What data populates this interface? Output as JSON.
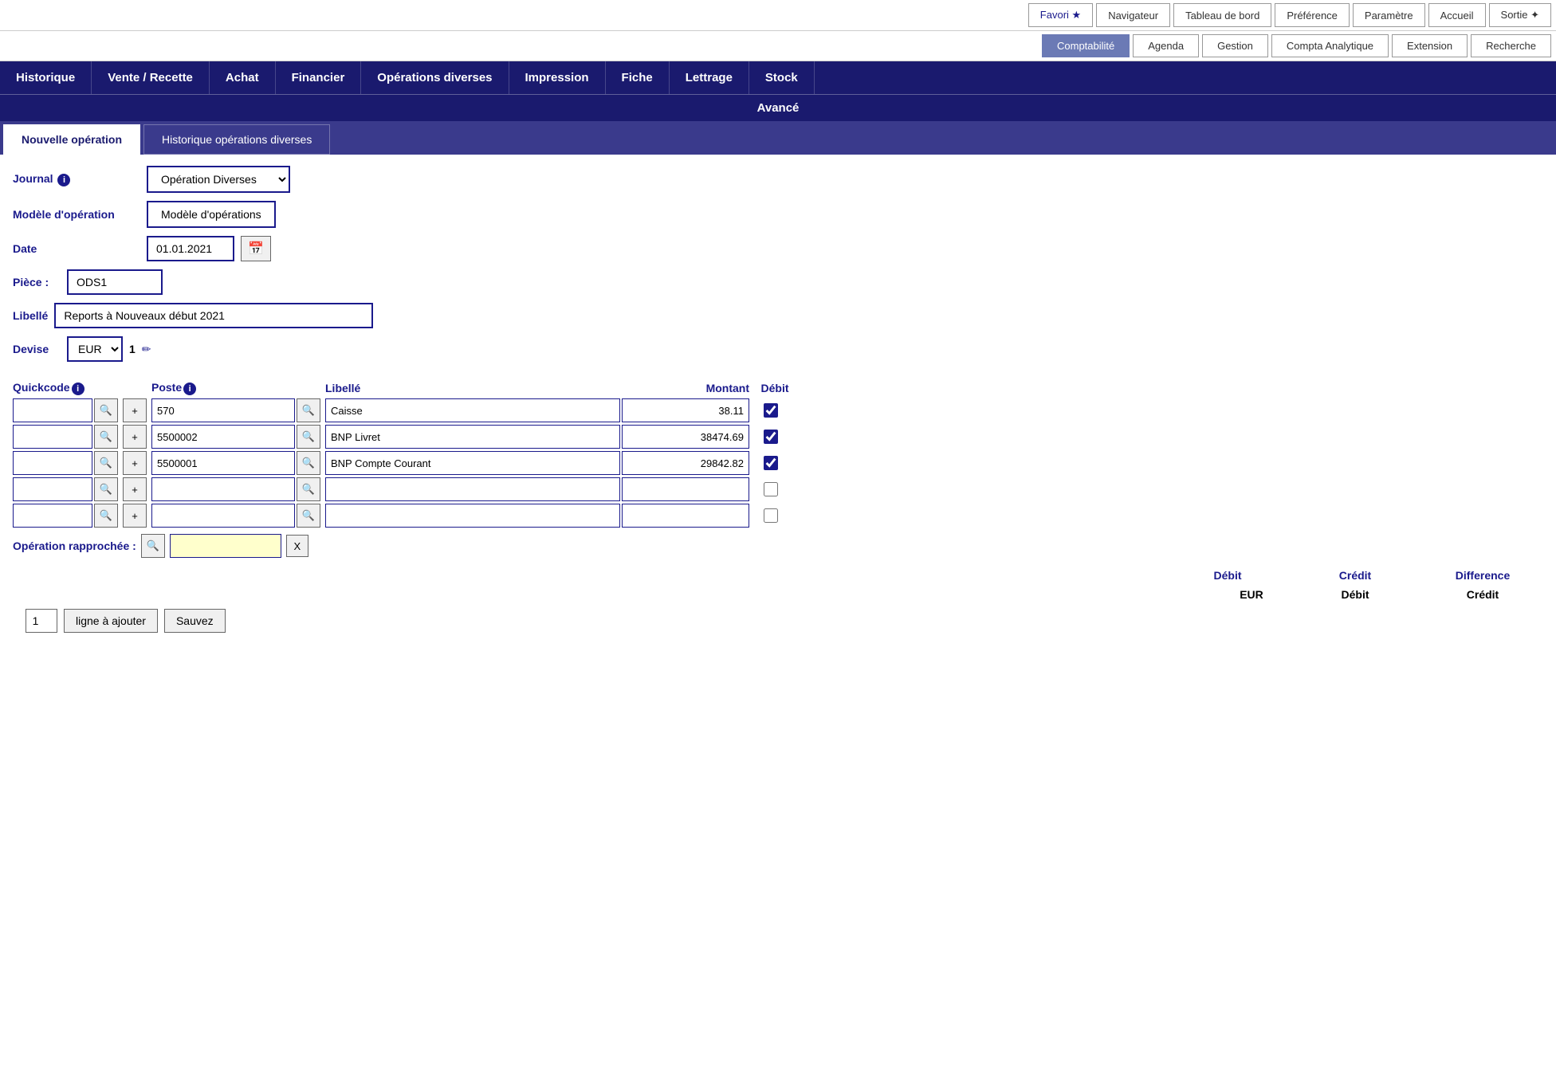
{
  "topNav": {
    "items": [
      {
        "id": "favori",
        "label": "Favori ★"
      },
      {
        "id": "navigateur",
        "label": "Navigateur"
      },
      {
        "id": "tableau-de-bord",
        "label": "Tableau de bord"
      },
      {
        "id": "preference",
        "label": "Préférence"
      },
      {
        "id": "parametre",
        "label": "Paramètre"
      },
      {
        "id": "accueil",
        "label": "Accueil"
      },
      {
        "id": "sortie",
        "label": "Sortie ✦"
      }
    ]
  },
  "secondNav": {
    "items": [
      {
        "id": "comptabilite",
        "label": "Comptabilité",
        "active": true
      },
      {
        "id": "agenda",
        "label": "Agenda"
      },
      {
        "id": "gestion",
        "label": "Gestion"
      },
      {
        "id": "compta-analytique",
        "label": "Compta Analytique"
      },
      {
        "id": "extension",
        "label": "Extension"
      },
      {
        "id": "recherche",
        "label": "Recherche"
      }
    ]
  },
  "mainMenu": {
    "items": [
      {
        "id": "historique",
        "label": "Historique"
      },
      {
        "id": "vente-recette",
        "label": "Vente / Recette"
      },
      {
        "id": "achat",
        "label": "Achat"
      },
      {
        "id": "financier",
        "label": "Financier"
      },
      {
        "id": "operations-diverses",
        "label": "Opérations diverses"
      },
      {
        "id": "impression",
        "label": "Impression"
      },
      {
        "id": "fiche",
        "label": "Fiche"
      },
      {
        "id": "lettrage",
        "label": "Lettrage"
      },
      {
        "id": "stock",
        "label": "Stock"
      }
    ]
  },
  "avanceBar": {
    "label": "Avancé"
  },
  "subTabs": {
    "items": [
      {
        "id": "nouvelle-operation",
        "label": "Nouvelle opération",
        "active": true
      },
      {
        "id": "historique-operations",
        "label": "Historique opérations diverses"
      }
    ]
  },
  "form": {
    "journalLabel": "Journal",
    "journalValue": "Opération Diverses",
    "modeleLabel": "Modèle d'opération",
    "modeleBtn": "Modèle d'opérations",
    "dateLabel": "Date",
    "dateValue": "01.01.2021",
    "pieceLabel": "Pièce :",
    "pieceValue": "ODS1",
    "libelleLabelMain": "Libellé",
    "libelleValue": "Reports à Nouveaux début 2021",
    "deviseLabel": "Devise",
    "deviseValue": "EUR",
    "deviseNum": "1",
    "calendarIcon": "📅",
    "editIcon": "✏"
  },
  "grid": {
    "headers": {
      "quickcode": "Quickcode",
      "poste": "Poste",
      "libelle": "Libellé",
      "montant": "Montant",
      "debit": "Débit"
    },
    "rows": [
      {
        "quickcode": "",
        "poste": "570",
        "libelle": "Caisse",
        "montant": "38.11",
        "debit": true,
        "empty": false
      },
      {
        "quickcode": "",
        "poste": "5500002",
        "libelle": "BNP Livret",
        "montant": "38474.69",
        "debit": true,
        "empty": false
      },
      {
        "quickcode": "",
        "poste": "5500001",
        "libelle": "BNP Compte Courant",
        "montant": "29842.82",
        "debit": true,
        "empty": false
      },
      {
        "quickcode": "",
        "poste": "",
        "libelle": "",
        "montant": "",
        "debit": false,
        "empty": true
      },
      {
        "quickcode": "",
        "poste": "",
        "libelle": "",
        "montant": "",
        "debit": false,
        "empty": true
      }
    ]
  },
  "opRapprochee": {
    "label": "Opération rapprochée :",
    "value": "",
    "xBtn": "X"
  },
  "totals": {
    "debitLabel": "Débit",
    "creditLabel": "Crédit",
    "differenceLabel": "Difference",
    "eurLabel": "EUR",
    "debitLabel2": "Débit",
    "creditLabel2": "Crédit"
  },
  "actions": {
    "numValue": "1",
    "ligneBtn": "ligne à ajouter",
    "sauveBtn": "Sauvez"
  }
}
